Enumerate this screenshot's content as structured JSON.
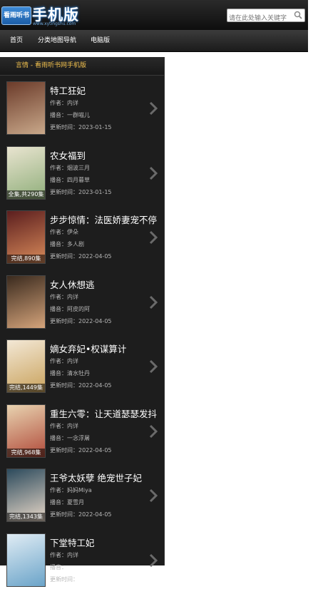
{
  "header": {
    "logo_badge": "看雨听书",
    "logo_title": "手机版",
    "logo_url": "www.xytingshu.com",
    "search_placeholder": "请在此处输入关键字"
  },
  "nav": {
    "items": [
      {
        "label": "首页"
      },
      {
        "label": "分类地图导航"
      },
      {
        "label": "电脑版"
      }
    ]
  },
  "notice": "言情 - 看雨听书网手机版",
  "labels": {
    "author": "作者：",
    "narrator": "播音：",
    "updated": "更新时间："
  },
  "books": [
    {
      "title": "特工狂妃",
      "author": "内详",
      "narrator": "一群喵儿",
      "updated": "2023-01-15",
      "badge": "",
      "cover_colors": [
        "#6b3b2a",
        "#c9a88a"
      ]
    },
    {
      "title": "农女福到",
      "author": "烟波三月",
      "narrator": "四月暮草",
      "updated": "2023-01-15",
      "badge": "全集,共290集",
      "cover_colors": [
        "#e9e4d0",
        "#8fae7a"
      ]
    },
    {
      "title": "步步惊情：法医娇妻宠不停",
      "author": "伊朵",
      "narrator": "多人剧",
      "updated": "2022-04-05",
      "badge": "完结,890集",
      "cover_colors": [
        "#5b1e1e",
        "#d88a5a"
      ]
    },
    {
      "title": "女人休想逃",
      "author": "内详",
      "narrator": "阿皮的阿",
      "updated": "2022-04-05",
      "badge": "",
      "cover_colors": [
        "#3a2a1e",
        "#d4a37a"
      ]
    },
    {
      "title": "嫡女弃妃•权谋算计",
      "author": "内详",
      "narrator": "清水牡丹",
      "updated": "2022-04-05",
      "badge": "完结,1449集",
      "cover_colors": [
        "#f3e8d6",
        "#c9a25c"
      ]
    },
    {
      "title": "重生六零：让天道瑟瑟发抖",
      "author": "内详",
      "narrator": "一念浮屠",
      "updated": "2022-04-05",
      "badge": "完结,968集",
      "cover_colors": [
        "#e8d3b0",
        "#b04a3a"
      ]
    },
    {
      "title": "王爷太妖孽 绝宠世子妃",
      "author": "妈妈Miya",
      "narrator": "夏雪月",
      "updated": "2022-04-05",
      "badge": "完结,1343集",
      "cover_colors": [
        "#2c4a5c",
        "#e8d8c8"
      ]
    },
    {
      "title": "下堂特工妃",
      "author": "内详",
      "narrator": "",
      "updated": "",
      "badge": "",
      "cover_colors": [
        "#e0ecf4",
        "#6ba4c9"
      ]
    }
  ]
}
